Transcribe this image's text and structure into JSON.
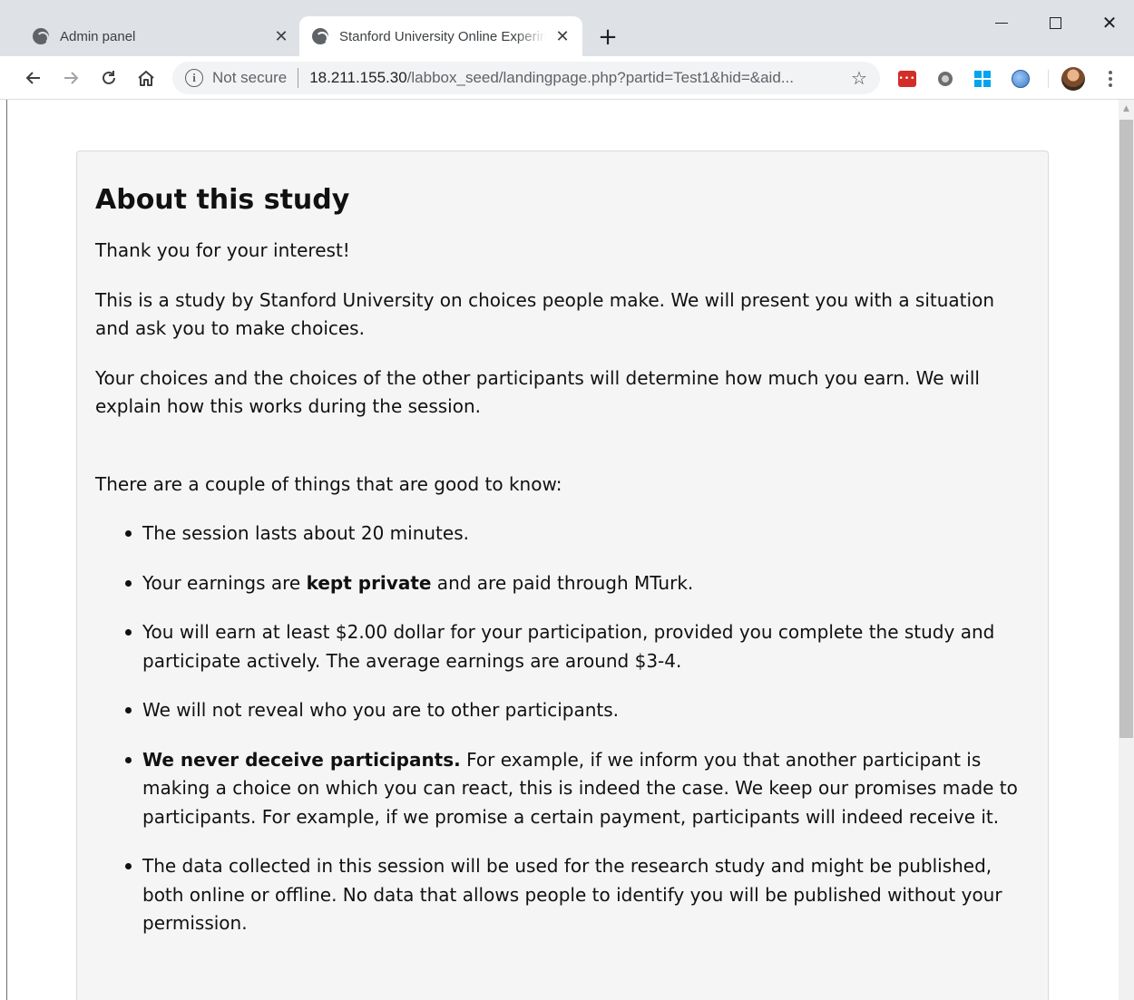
{
  "browser": {
    "tabs": [
      {
        "title": "Admin panel",
        "active": false
      },
      {
        "title": "Stanford University Online Experiments",
        "active": true
      }
    ],
    "new_tab_label": "+",
    "address_bar": {
      "security_label": "Not secure",
      "url_host": "18.211.155.30",
      "url_path": "/labbox_seed/landingpage.php?partid=Test1&hid=&aid..."
    },
    "icons": {
      "back": "arrow-left-icon",
      "forward": "arrow-right-icon",
      "reload": "reload-icon",
      "home": "home-icon",
      "bookmark": "star-icon",
      "menu": "kebab-menu-icon"
    }
  },
  "page": {
    "title": "About this study",
    "intro": "Thank you for your interest!",
    "para1": "This is a study by Stanford University on choices people make. We will present you with a situation and ask you to make choices.",
    "para2": "Your choices and the choices of the other participants will determine how much you earn. We will explain how this works during the session.",
    "para3": "There are a couple of things that are good to know:",
    "bullets": {
      "b1": "The session lasts about 20 minutes.",
      "b2_pre": "Your earnings are ",
      "b2_bold": "kept private",
      "b2_post": " and are paid through MTurk.",
      "b3": "You will earn at least $2.00 dollar for your participation, provided you complete the study and participate actively. The average earnings are around $3-4.",
      "b4": "We will not reveal who you are to other participants.",
      "b5_bold": "We never deceive participants.",
      "b5_post": " For example, if we inform you that another participant is making a choice on which you can react, this is indeed the case. We keep our promises made to participants. For example, if we promise a certain payment, participants will indeed receive it.",
      "b6": "The data collected in this session will be used for the research study and might be published, both online or offline. No data that allows people to identify you will be published without your permission."
    }
  }
}
